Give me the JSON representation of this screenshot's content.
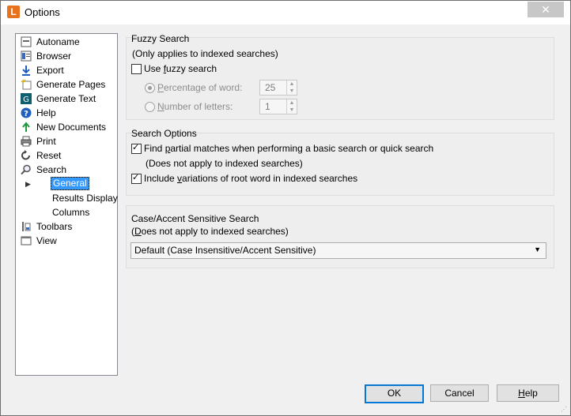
{
  "window": {
    "title": "Options",
    "app_icon_letter": "L"
  },
  "tree": {
    "items": [
      {
        "label": "Autoname",
        "icon": "autoname-icon"
      },
      {
        "label": "Browser",
        "icon": "browser-icon"
      },
      {
        "label": "Export",
        "icon": "export-arrow-icon"
      },
      {
        "label": "Generate Pages",
        "icon": "generate-pages-icon"
      },
      {
        "label": "Generate Text",
        "icon": "generate-text-icon"
      },
      {
        "label": "Help",
        "icon": "help-icon"
      },
      {
        "label": "New Documents",
        "icon": "new-documents-icon"
      },
      {
        "label": "Print",
        "icon": "print-icon"
      },
      {
        "label": "Reset",
        "icon": "reset-icon"
      },
      {
        "label": "Search",
        "icon": "search-icon"
      },
      {
        "label": "General",
        "icon": ""
      },
      {
        "label": "Results Display",
        "icon": ""
      },
      {
        "label": "Columns",
        "icon": ""
      },
      {
        "label": "Toolbars",
        "icon": "toolbars-icon"
      },
      {
        "label": "View",
        "icon": "view-icon"
      }
    ]
  },
  "fuzzy": {
    "title": "Fuzzy Search",
    "note": "(Only applies to indexed searches)",
    "use_fuzzy_pre": "Use ",
    "use_fuzzy_u": "f",
    "use_fuzzy_post": "uzzy search",
    "use_fuzzy_checked": false,
    "percentage_u": "P",
    "percentage_post": "ercentage of word:",
    "percentage_value": "25",
    "number_u": "N",
    "number_post": "umber of letters:",
    "number_value": "1"
  },
  "search_options": {
    "title": "Search Options",
    "partial_pre": "Find ",
    "partial_u": "p",
    "partial_post": "artial matches when performing a basic search or quick search",
    "partial_checked": true,
    "partial_note": "(Does not apply to indexed searches)",
    "variations_pre": "Include ",
    "variations_u": "v",
    "variations_post": "ariations of root word in indexed searches",
    "variations_checked": true
  },
  "case": {
    "title": "Case/Accent Sensitive Search",
    "note_u": "D",
    "note_post": "oes not apply to indexed searches)",
    "note_pre": "(",
    "selected": "Default (Case Insensitive/Accent Sensitive)"
  },
  "buttons": {
    "ok": "OK",
    "cancel": "Cancel",
    "help_u": "H",
    "help_post": "elp"
  }
}
